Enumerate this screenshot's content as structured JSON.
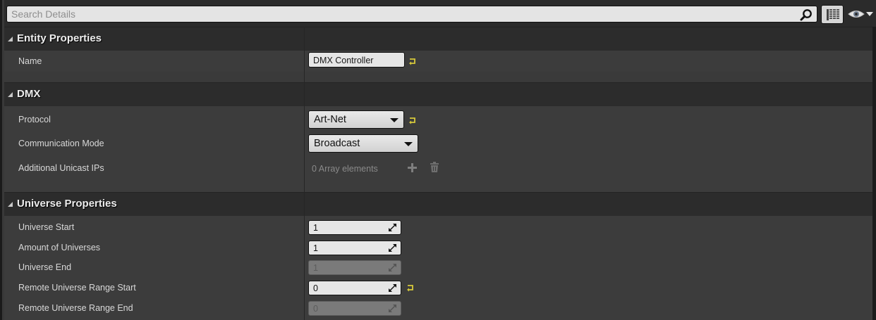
{
  "search": {
    "placeholder": "Search Details"
  },
  "toolbar": {
    "view_options_icon": "grid-list-icon",
    "visibility_icon": "eye-dropdown-icon"
  },
  "categories": [
    {
      "title": "Entity Properties",
      "rows": [
        {
          "label": "Name",
          "value": "DMX Controller",
          "widget": "text"
        }
      ]
    },
    {
      "title": "DMX",
      "rows": [
        {
          "label": "Protocol",
          "value": "Art-Net",
          "widget": "combo"
        },
        {
          "label": "Communication Mode",
          "value": "Broadcast",
          "widget": "combo"
        },
        {
          "label": "Additional Unicast IPs",
          "value": "0 Array elements",
          "widget": "array"
        }
      ]
    },
    {
      "title": "Universe Properties",
      "rows": [
        {
          "label": "Universe Start",
          "value": "1",
          "widget": "number"
        },
        {
          "label": "Amount of Universes",
          "value": "1",
          "widget": "number"
        },
        {
          "label": "Universe End",
          "value": "1",
          "widget": "number",
          "disabled": true
        },
        {
          "label": "Remote Universe Range Start",
          "value": "0",
          "widget": "number"
        },
        {
          "label": "Remote Universe Range End",
          "value": "0",
          "widget": "number",
          "disabled": true
        }
      ]
    }
  ],
  "colors": {
    "background": "#3c3c3c",
    "category_header": "#2c2c2c",
    "reset_arrow": "#d7c93a",
    "input_bg": "#e6e6e6",
    "disabled_input_bg": "#7a7a7a"
  }
}
